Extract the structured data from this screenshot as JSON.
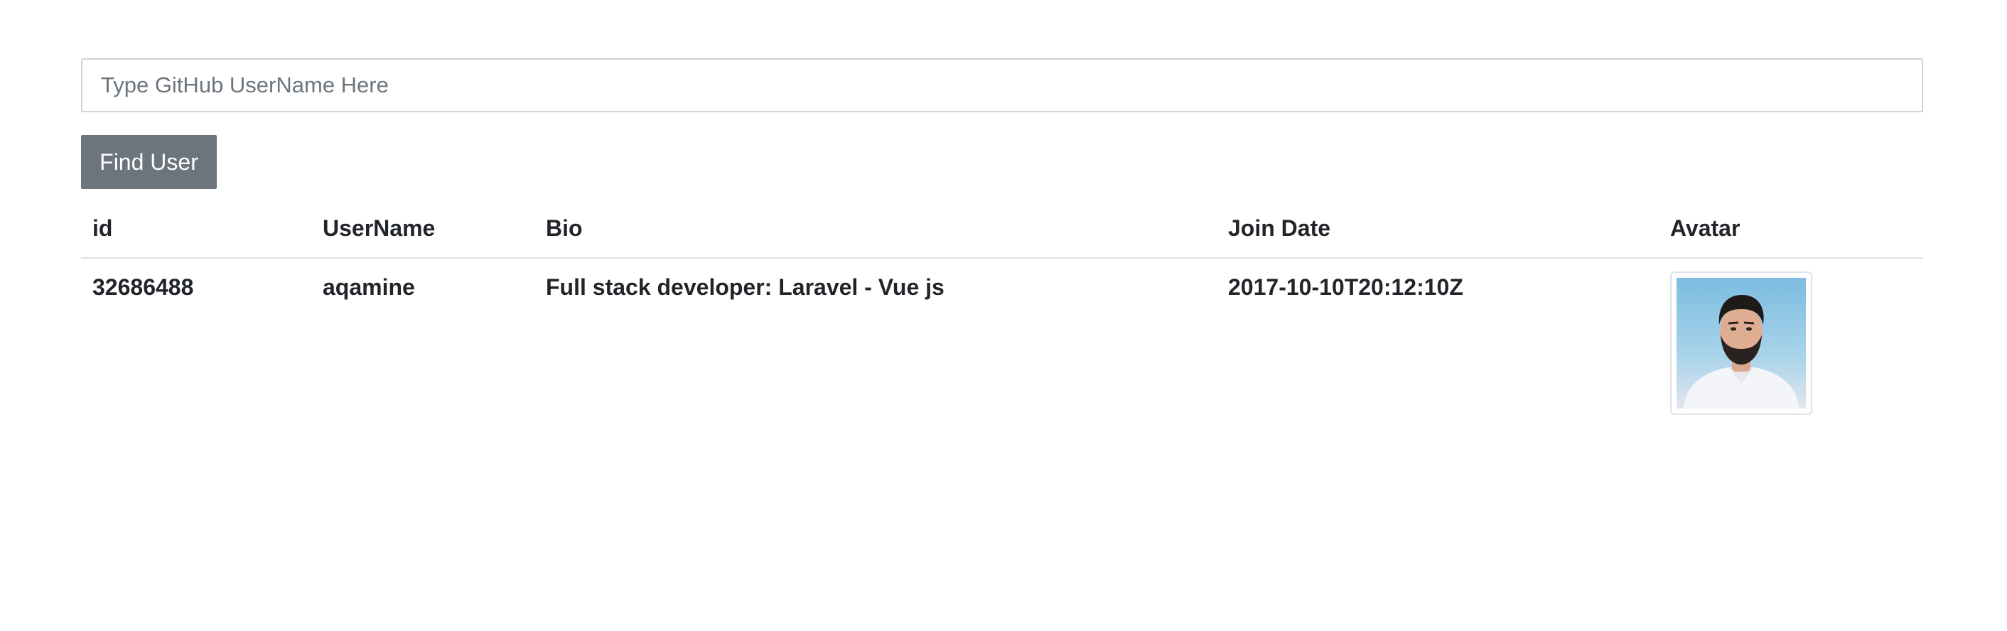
{
  "search": {
    "placeholder": "Type GitHub UserName Here",
    "value": ""
  },
  "actions": {
    "find_label": "Find User"
  },
  "table": {
    "headers": {
      "id": "id",
      "username": "UserName",
      "bio": "Bio",
      "join_date": "Join Date",
      "avatar": "Avatar"
    },
    "rows": [
      {
        "id": "32686488",
        "username": "aqamine",
        "bio": "Full stack developer: Laravel - Vue js",
        "join_date": "2017-10-10T20:12:10Z",
        "avatar_icon": "user-photo"
      }
    ]
  },
  "colors": {
    "button_bg": "#6c757d",
    "text": "#212529",
    "border": "#ced4da",
    "avatar_background": "#8fc6e2"
  }
}
